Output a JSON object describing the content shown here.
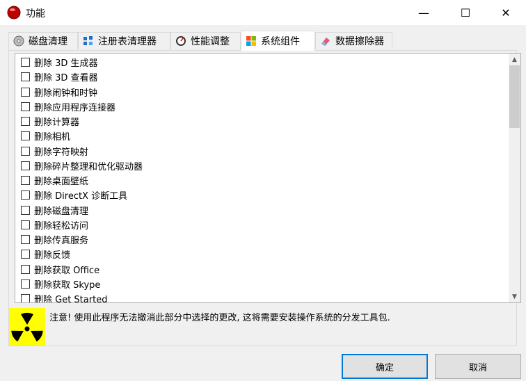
{
  "window": {
    "title": "功能",
    "min": "—",
    "max": "☐",
    "close": "✕"
  },
  "tabs": [
    {
      "label": "磁盘清理",
      "icon": "disk-icon"
    },
    {
      "label": "注册表清理器",
      "icon": "registry-icon"
    },
    {
      "label": "性能调整",
      "icon": "gauge-icon"
    },
    {
      "label": "系统组件",
      "icon": "windows-icon",
      "active": true
    },
    {
      "label": "数据擦除器",
      "icon": "eraser-icon"
    }
  ],
  "items": [
    "删除 3D 生成器",
    "删除 3D 查看器",
    "删除闹钟和时钟",
    "删除应用程序连接器",
    "删除计算器",
    "删除相机",
    "删除字符映射",
    "删除碎片整理和优化驱动器",
    "删除桌面壁纸",
    "删除 DirectX 诊断工具",
    "删除磁盘清理",
    "删除轻松访问",
    "删除传真服务",
    "删除反馈",
    "删除获取 Office",
    "删除获取 Skype",
    "删除 Get Started"
  ],
  "warning": {
    "text": "注意! 使用此程序无法撤消此部分中选择的更改, 这将需要安装操作系统的分发工具包.",
    "icon": "radiation-icon"
  },
  "buttons": {
    "ok": "确定",
    "cancel": "取消"
  },
  "colors": {
    "accent": "#0078d7",
    "warning_bg": "#ffff00"
  }
}
